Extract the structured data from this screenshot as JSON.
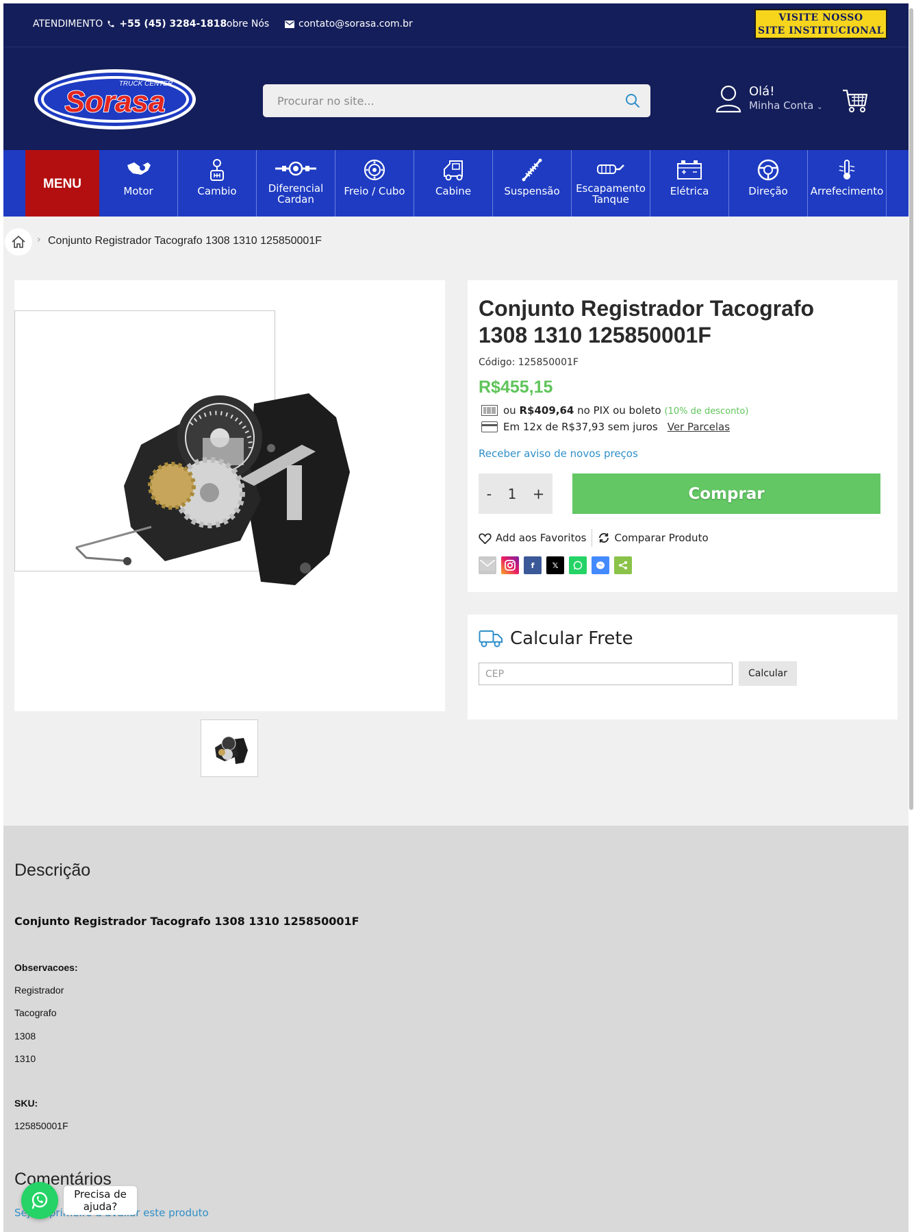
{
  "topbar": {
    "atendimento_label": "ATENDIMENTO",
    "phone": "+55 (45) 3284-1818",
    "sobre": "Sobre Nós",
    "email": "contato@sorasa.com.br",
    "visite_line1": "VISITE NOSSO",
    "visite_line2": "SITE INSTITUCIONAL"
  },
  "logo": {
    "brand": "Sorasa",
    "tagline": "TRUCK CENTER"
  },
  "search": {
    "placeholder": "Procurar no site..."
  },
  "account": {
    "greeting": "Olá!",
    "label": "Minha Conta"
  },
  "nav": {
    "menu_label": "MENU",
    "categories": [
      {
        "label": "Motor",
        "icon": "engine-icon"
      },
      {
        "label": "Cambio",
        "icon": "gearshift-icon"
      },
      {
        "label1": "Diferencial",
        "label2": "Cardan",
        "icon": "differential-icon"
      },
      {
        "label": "Freio / Cubo",
        "icon": "brake-disc-icon"
      },
      {
        "label": "Cabine",
        "icon": "truck-cab-icon"
      },
      {
        "label": "Suspensão",
        "icon": "shock-absorber-icon"
      },
      {
        "label1": "Escapamento",
        "label2": "Tanque",
        "icon": "exhaust-icon"
      },
      {
        "label": "Elétrica",
        "icon": "battery-icon"
      },
      {
        "label": "Direção",
        "icon": "steering-wheel-icon"
      },
      {
        "label": "Arrefecimento",
        "icon": "thermometer-icon"
      }
    ]
  },
  "breadcrumb": {
    "current": "Conjunto Registrador Tacografo 1308 1310 125850001F"
  },
  "product": {
    "title": "Conjunto Registrador Tacografo 1308 1310 125850001F",
    "codigo": "Código: 125850001F",
    "price": "R$455,15",
    "pix_prefix": "ou",
    "pix_price": "R$409,64",
    "pix_text": "no PIX ou boleto",
    "pix_discount": "(10% de desconto)",
    "installments": "Em 12x de R$37,93 sem juros",
    "ver_parcelas": "Ver Parcelas",
    "aviso": "Receber aviso de novos preços",
    "qty_minus": "-",
    "qty_value": "1",
    "qty_plus": "+",
    "buy": "Comprar",
    "favorite": "Add aos Favoritos",
    "compare": "Comparar Produto"
  },
  "frete": {
    "title": "Calcular Frete",
    "placeholder": "CEP",
    "button": "Calcular"
  },
  "description": {
    "heading": "Descrição",
    "product_title": "Conjunto Registrador Tacografo 1308 1310 125850001F",
    "obs_label": "Observacoes:",
    "obs_lines": [
      "Registrador",
      "Tacografo",
      "1308",
      "1310"
    ],
    "sku_label": "SKU:",
    "sku": "125850001F",
    "comments_heading": "Comentários",
    "first_review": "Seja o primeiro a avaliar este produto"
  },
  "whatsapp": {
    "line1": "Precisa de",
    "line2": "ajuda?"
  },
  "colors": {
    "navy": "#141e5a",
    "nav_blue": "#1e3bc2",
    "menu_red": "#b40f10",
    "buy_green": "#63c764",
    "price_green": "#5fc45a",
    "link_blue": "#2e8fc9",
    "yellow": "#f7d51d"
  }
}
